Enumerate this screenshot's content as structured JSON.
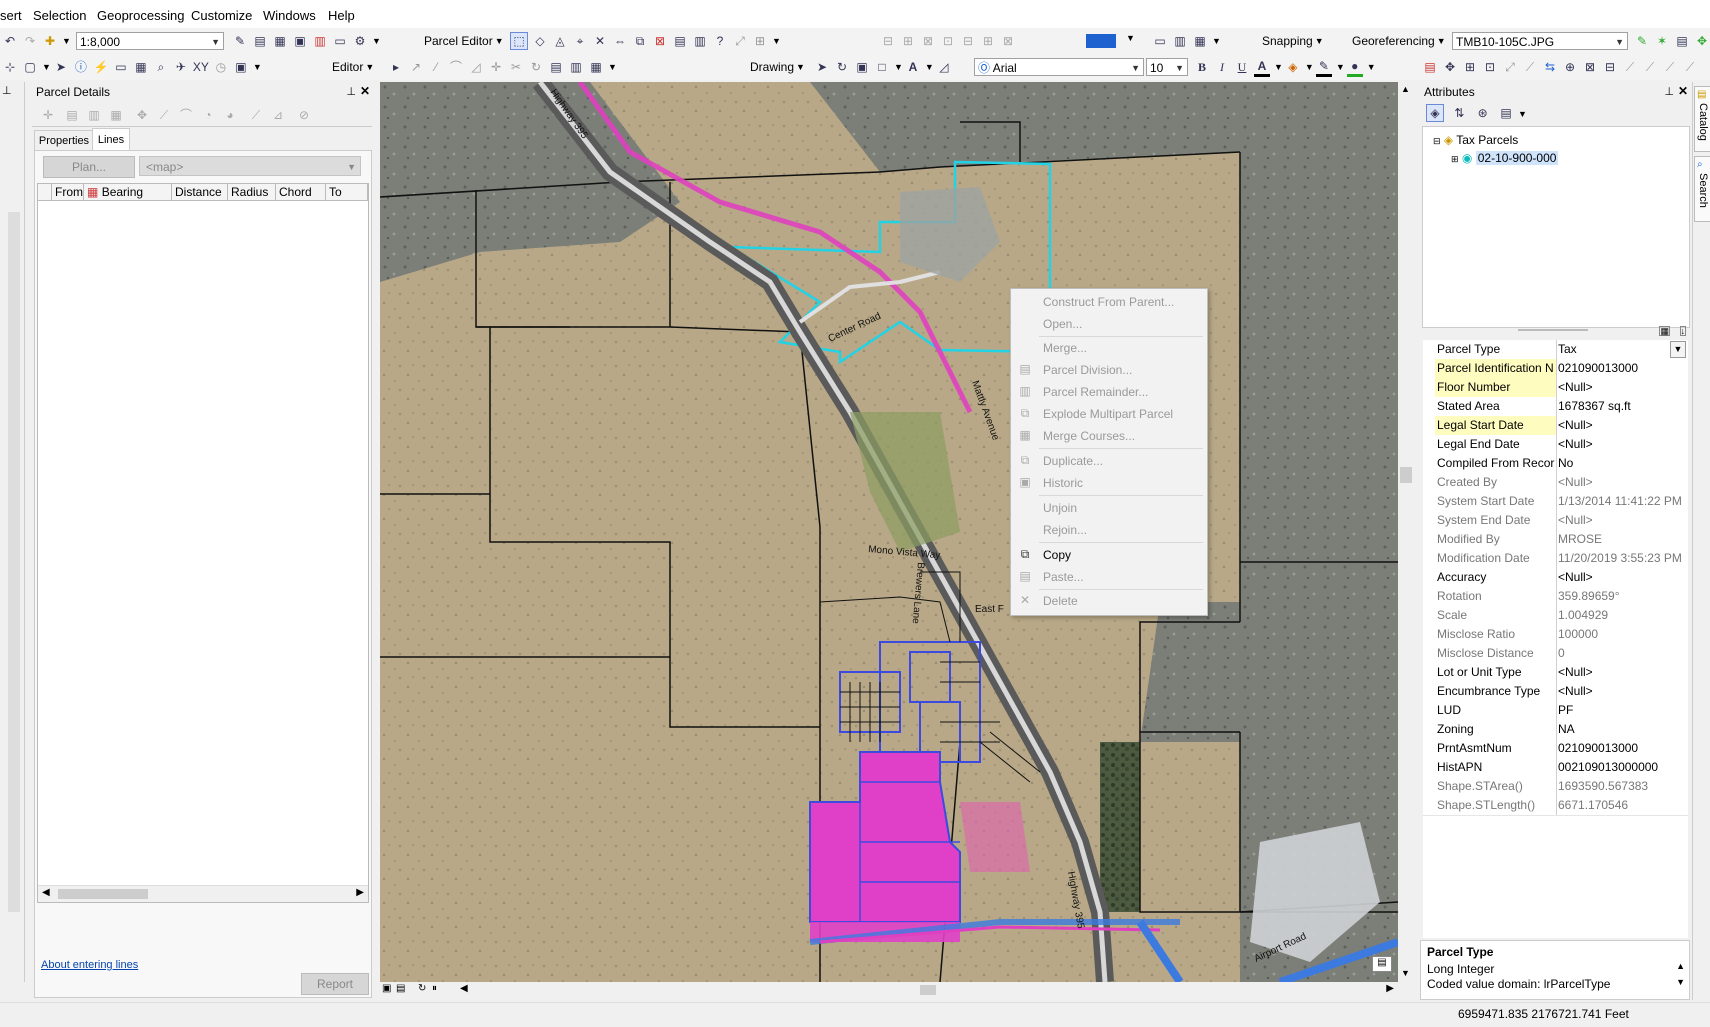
{
  "menubar": [
    "sert",
    "Selection",
    "Geoprocessing",
    "Customize",
    "Windows",
    "Help"
  ],
  "toolbar1": {
    "scale": "1:8,000",
    "parcel_editor": "Parcel Editor",
    "snapping": "Snapping",
    "georeferencing": "Georeferencing",
    "raster_layer": "TMB10-105C.JPG"
  },
  "toolbar2": {
    "editor": "Editor",
    "drawing": "Drawing",
    "font": "Arial",
    "font_size": "10",
    "bold": "B",
    "italic": "I",
    "underline": "U",
    "font_color_glyph": "A"
  },
  "parcel_details": {
    "title": "Parcel Details",
    "tabs": [
      "Properties",
      "Lines"
    ],
    "plan_button": "Plan...",
    "map_combo": "<map>",
    "columns": [
      "From",
      "Bearing",
      "Distance",
      "Radius",
      "Chord",
      "To"
    ],
    "about_link": "About entering lines",
    "report_button": "Report"
  },
  "map": {
    "labels": {
      "highway395_top": "Highway 395",
      "center_road": "Center Road",
      "mattly_avenue": "Mattly Avenue",
      "mono_vista_way": "Mono Vista Way",
      "brewers_lane": "Brewers Lane",
      "east_f": "East F",
      "airport_road": "Airport Road",
      "highway395_bottom": "Highway 395"
    }
  },
  "context_menu": {
    "items": [
      {
        "label": "Construct From Parent...",
        "enabled": false
      },
      {
        "label": "Open...",
        "enabled": false
      },
      {
        "label": "Merge...",
        "enabled": false
      },
      {
        "label": "Parcel Division...",
        "enabled": false
      },
      {
        "label": "Parcel Remainder...",
        "enabled": false
      },
      {
        "label": "Explode Multipart Parcel",
        "enabled": false
      },
      {
        "label": "Merge Courses...",
        "enabled": false
      },
      {
        "label": "Duplicate...",
        "enabled": false
      },
      {
        "label": "Historic",
        "enabled": false
      },
      {
        "label": "Unjoin",
        "enabled": false
      },
      {
        "label": "Rejoin...",
        "enabled": false
      },
      {
        "label": "Copy",
        "enabled": true
      },
      {
        "label": "Paste...",
        "enabled": false
      },
      {
        "label": "Delete",
        "enabled": false
      }
    ]
  },
  "attributes": {
    "title": "Attributes",
    "tree_root": "Tax Parcels",
    "tree_child": "02-10-900-000",
    "rows": [
      {
        "k": "Parcel Type",
        "v": "Tax",
        "style": "header"
      },
      {
        "k": "Parcel Identification N",
        "v": "021090013000",
        "style": "yellow"
      },
      {
        "k": "Floor Number",
        "v": "<Null>",
        "style": "yellow"
      },
      {
        "k": "Stated Area",
        "v": "1678367 sq.ft",
        "style": "normal"
      },
      {
        "k": "Legal Start Date",
        "v": "<Null>",
        "style": "yellow"
      },
      {
        "k": "Legal End Date",
        "v": "<Null>",
        "style": "normal"
      },
      {
        "k": "Compiled From Recor",
        "v": "No",
        "style": "normal"
      },
      {
        "k": "Created By",
        "v": "<Null>",
        "style": "grey"
      },
      {
        "k": "System Start Date",
        "v": "1/13/2014 11:41:22 PM",
        "style": "grey"
      },
      {
        "k": "System End Date",
        "v": "<Null>",
        "style": "grey"
      },
      {
        "k": "Modified By",
        "v": "MROSE",
        "style": "grey"
      },
      {
        "k": "Modification Date",
        "v": "11/20/2019 3:55:23 PM",
        "style": "grey"
      },
      {
        "k": "Accuracy",
        "v": "<Null>",
        "style": "normal"
      },
      {
        "k": "Rotation",
        "v": "359.89659°",
        "style": "grey"
      },
      {
        "k": "Scale",
        "v": "1.004929",
        "style": "grey"
      },
      {
        "k": "Misclose Ratio",
        "v": "100000",
        "style": "grey"
      },
      {
        "k": "Misclose Distance",
        "v": "0",
        "style": "grey"
      },
      {
        "k": "Lot or Unit Type",
        "v": "<Null>",
        "style": "normal"
      },
      {
        "k": "Encumbrance Type",
        "v": "<Null>",
        "style": "normal"
      },
      {
        "k": "LUD",
        "v": "PF",
        "style": "normal"
      },
      {
        "k": "Zoning",
        "v": "NA",
        "style": "normal"
      },
      {
        "k": "PrntAsmtNum",
        "v": "021090013000",
        "style": "normal"
      },
      {
        "k": "HistAPN",
        "v": "002109013000000",
        "style": "normal"
      },
      {
        "k": "Shape.STArea()",
        "v": "1693590.567383",
        "style": "grey"
      },
      {
        "k": "Shape.STLength()",
        "v": "6671.170546",
        "style": "grey"
      }
    ],
    "desc_title": "Parcel Type",
    "desc_line1": "Long Integer",
    "desc_line2": "Coded value domain: lrParcelType"
  },
  "side_tabs": [
    "Catalog",
    "Search"
  ],
  "status": {
    "coords": "6959471.835  2176721.741 Feet"
  }
}
